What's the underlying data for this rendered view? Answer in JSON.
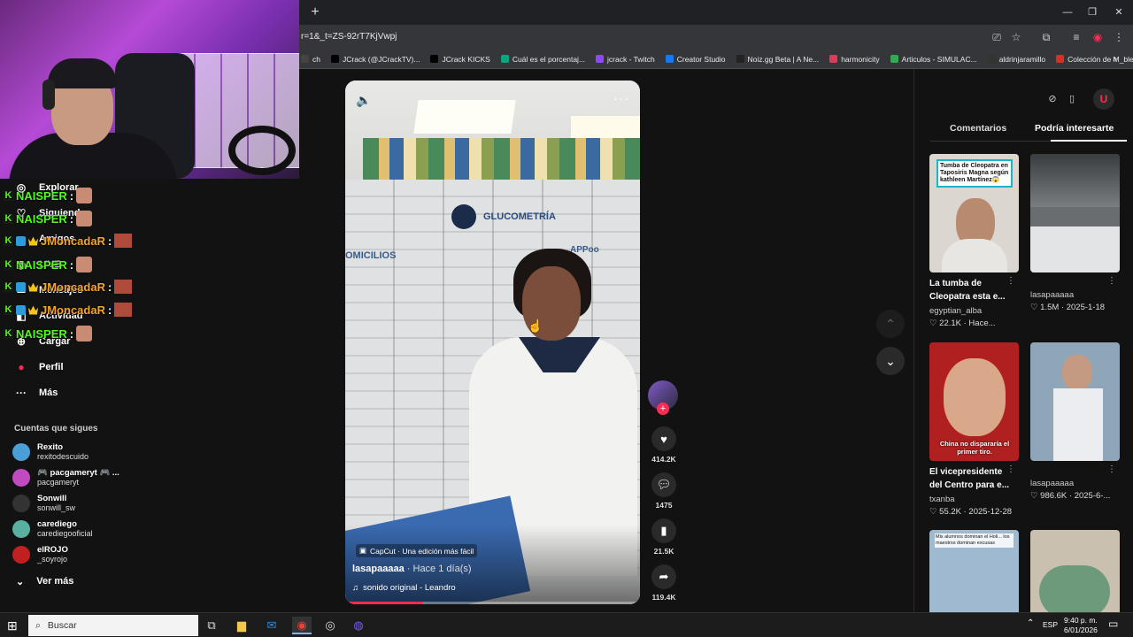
{
  "browser": {
    "new_tab": "+",
    "url": "r=1&_t=ZS-92rT7KjVwpj",
    "bookmarks": [
      {
        "label": "ch",
        "color": "#444444"
      },
      {
        "label": "JCrack (@JCrackTV)...",
        "color": "#000000"
      },
      {
        "label": "JCrack KICKS",
        "color": "#000000"
      },
      {
        "label": "Cuál es el porcentaj...",
        "color": "#10a37f"
      },
      {
        "label": "jcrack - Twitch",
        "color": "#9146ff"
      },
      {
        "label": "Creator Studio",
        "color": "#1877f2"
      },
      {
        "label": "Noiz.gg Beta | A Ne...",
        "color": "#222222"
      },
      {
        "label": "harmonicity",
        "color": "#e03a5a"
      },
      {
        "label": "Articulos - SIMULAC...",
        "color": "#34a853"
      },
      {
        "label": "aldrinjaramillo",
        "color": "#333333"
      },
      {
        "label": "Colección de M_blei...",
        "color": "#d93025"
      }
    ],
    "more": "»"
  },
  "sidebar": {
    "nav": [
      {
        "label": "Explorar",
        "icon": "◎"
      },
      {
        "label": "Siguiendo",
        "icon": "♡"
      },
      {
        "label": "Amigos",
        "icon": "☺"
      },
      {
        "label": "LIVE",
        "icon": "◉"
      },
      {
        "label": "Mensajes",
        "icon": "✉"
      },
      {
        "label": "Actividad",
        "icon": "◧"
      },
      {
        "label": "Cargar",
        "icon": "⊕"
      },
      {
        "label": "Perfil",
        "icon": "●"
      },
      {
        "label": "Más",
        "icon": "···"
      }
    ],
    "following_title": "Cuentas que sigues",
    "accounts": [
      {
        "name": "Rexito",
        "handle": "rexitodescuido",
        "color": "#4a9fd8"
      },
      {
        "name": "🎮 pacgameryt 🎮 ...",
        "handle": "pacgameryt",
        "color": "#c04ac0"
      },
      {
        "name": "Sonwill",
        "handle": "sonwill_sw",
        "color": "#333333"
      },
      {
        "name": "carediego",
        "handle": "carediegooficial",
        "color": "#5ab0a0"
      },
      {
        "name": "elROJO",
        "handle": "_soyrojo",
        "color": "#c02020"
      }
    ],
    "see_more": "Ver más"
  },
  "chat": [
    {
      "user": "NAISPER",
      "color": "#53fc18",
      "emote": "face",
      "crown": false
    },
    {
      "user": "NAISPER",
      "color": "#53fc18",
      "emote": "face",
      "crown": false
    },
    {
      "user": "JMoncadaR",
      "color": "#f5a623",
      "emote": "pic",
      "crown": true
    },
    {
      "user": "NAISPER",
      "color": "#53fc18",
      "emote": "face",
      "crown": false
    },
    {
      "user": "JMoncadaR",
      "color": "#f5a623",
      "emote": "pic",
      "crown": true
    },
    {
      "user": "JMoncadaR",
      "color": "#f5a623",
      "emote": "pic",
      "crown": true
    },
    {
      "user": "NAISPER",
      "color": "#53fc18",
      "emote": "face",
      "crown": false
    }
  ],
  "video": {
    "sign_gluco": "GLUCOMETRÍA",
    "sign_domi": "OMICILIOS",
    "sign_app": "APPoo",
    "capcut": "CapCut · Una edición más fácil",
    "author": "lasapaaaaa",
    "time": " · Hace 1 día(s)",
    "music": "sonido original - Leandro",
    "progress": 0.26
  },
  "actions": {
    "likes": "414.2K",
    "comments": "1475",
    "saves": "21.5K",
    "shares": "119.4K"
  },
  "right_panel": {
    "tabs": [
      "Comentarios",
      "Podría interesarte"
    ],
    "cards": [
      {
        "title": "La tumba de Cleopatra esta e...",
        "author": "egyptian_alba",
        "stats": "♡ 22.1K · Hace...",
        "thumb_text": "Tumba de Cleopatra en Taposiris Magna según kathleen Martínez😱",
        "bg": "#dcd6d0"
      },
      {
        "title": "",
        "author": "lasapaaaaa",
        "stats": "♡ 1.5M · 2025-1-18",
        "thumb_text": "",
        "bg": "#6a6d70"
      },
      {
        "title": "El vicepresidente del Centro para e...",
        "author": "txanba",
        "stats": "♡ 55.2K · 2025-12-28",
        "thumb_text": "China no dispararía el primer tiro.",
        "bg": "#b02020"
      },
      {
        "title": "",
        "author": "lasapaaaaa",
        "stats": "♡ 986.6K · 2025-6-...",
        "thumb_text": "",
        "bg": "#8fa6b8"
      },
      {
        "title": "",
        "author": "",
        "stats": "",
        "thumb_text": "Mis alumnos dominan el Holi... los maestros dominan excusas",
        "bg": "#9fbad0"
      },
      {
        "title": "",
        "author": "",
        "stats": "",
        "thumb_text": "",
        "bg": "#c9c0b0"
      }
    ]
  },
  "taskbar": {
    "search": "Buscar",
    "lang": "ESP",
    "time": "9:40 p. m.",
    "date": "6/01/2026"
  }
}
